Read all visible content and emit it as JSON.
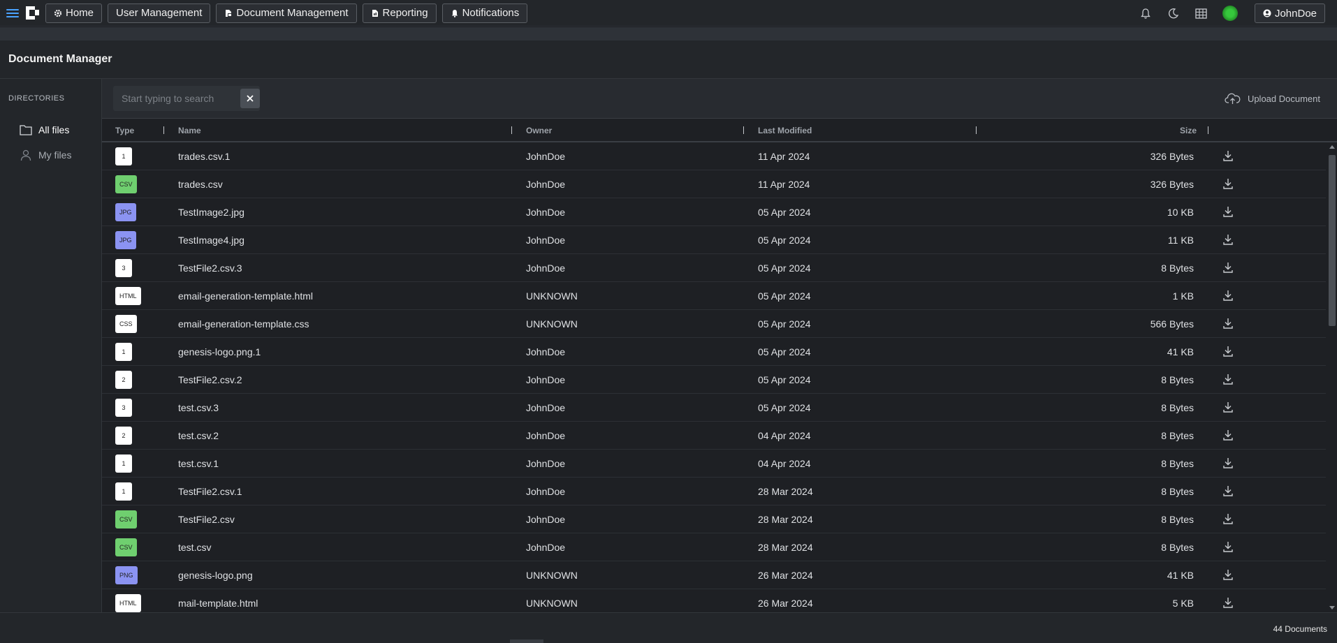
{
  "nav": {
    "items": [
      {
        "label": "Home",
        "icon": "gear-icon"
      },
      {
        "label": "User Management",
        "icon": ""
      },
      {
        "label": "Document Management",
        "icon": "document-icon"
      },
      {
        "label": "Reporting",
        "icon": "report-icon"
      },
      {
        "label": "Notifications",
        "icon": "bell-icon"
      }
    ],
    "user_label": "JohnDoe"
  },
  "page": {
    "title": "Document Manager"
  },
  "sidebar": {
    "heading": "DIRECTORIES",
    "items": [
      {
        "label": "All files",
        "icon": "folder-icon",
        "active": true
      },
      {
        "label": "My files",
        "icon": "user-icon",
        "active": false
      }
    ]
  },
  "toolbar": {
    "search_placeholder": "Start typing to search",
    "search_value": "",
    "upload_label": "Upload Document"
  },
  "table": {
    "columns": [
      "Type",
      "Name",
      "Owner",
      "Last Modified",
      "Size"
    ],
    "rows": [
      {
        "type": "1",
        "name": "trades.csv.1",
        "owner": "JohnDoe",
        "modified": "11 Apr 2024",
        "size": "326 Bytes"
      },
      {
        "type": "CSV",
        "name": "trades.csv",
        "owner": "JohnDoe",
        "modified": "11 Apr 2024",
        "size": "326 Bytes"
      },
      {
        "type": "JPG",
        "name": "TestImage2.jpg",
        "owner": "JohnDoe",
        "modified": "05 Apr 2024",
        "size": "10 KB"
      },
      {
        "type": "JPG",
        "name": "TestImage4.jpg",
        "owner": "JohnDoe",
        "modified": "05 Apr 2024",
        "size": "11 KB"
      },
      {
        "type": "3",
        "name": "TestFile2.csv.3",
        "owner": "JohnDoe",
        "modified": "05 Apr 2024",
        "size": "8 Bytes"
      },
      {
        "type": "HTML",
        "name": "email-generation-template.html",
        "owner": "UNKNOWN",
        "modified": "05 Apr 2024",
        "size": "1 KB"
      },
      {
        "type": "CSS",
        "name": "email-generation-template.css",
        "owner": "UNKNOWN",
        "modified": "05 Apr 2024",
        "size": "566 Bytes"
      },
      {
        "type": "1",
        "name": "genesis-logo.png.1",
        "owner": "JohnDoe",
        "modified": "05 Apr 2024",
        "size": "41 KB"
      },
      {
        "type": "2",
        "name": "TestFile2.csv.2",
        "owner": "JohnDoe",
        "modified": "05 Apr 2024",
        "size": "8 Bytes"
      },
      {
        "type": "3",
        "name": "test.csv.3",
        "owner": "JohnDoe",
        "modified": "05 Apr 2024",
        "size": "8 Bytes"
      },
      {
        "type": "2",
        "name": "test.csv.2",
        "owner": "JohnDoe",
        "modified": "04 Apr 2024",
        "size": "8 Bytes"
      },
      {
        "type": "1",
        "name": "test.csv.1",
        "owner": "JohnDoe",
        "modified": "04 Apr 2024",
        "size": "8 Bytes"
      },
      {
        "type": "1",
        "name": "TestFile2.csv.1",
        "owner": "JohnDoe",
        "modified": "28 Mar 2024",
        "size": "8 Bytes"
      },
      {
        "type": "CSV",
        "name": "TestFile2.csv",
        "owner": "JohnDoe",
        "modified": "28 Mar 2024",
        "size": "8 Bytes"
      },
      {
        "type": "CSV",
        "name": "test.csv",
        "owner": "JohnDoe",
        "modified": "28 Mar 2024",
        "size": "8 Bytes"
      },
      {
        "type": "PNG",
        "name": "genesis-logo.png",
        "owner": "UNKNOWN",
        "modified": "26 Mar 2024",
        "size": "41 KB"
      },
      {
        "type": "HTML",
        "name": "mail-template.html",
        "owner": "UNKNOWN",
        "modified": "26 Mar 2024",
        "size": "5 KB"
      }
    ]
  },
  "footer": {
    "count": "44 Documents"
  },
  "colors": {
    "accent": "#4aa3ff",
    "csv_badge": "#6fcf6f",
    "image_badge": "#8b93f2",
    "default_badge": "#ffffff",
    "status_online": "#36c83c"
  }
}
